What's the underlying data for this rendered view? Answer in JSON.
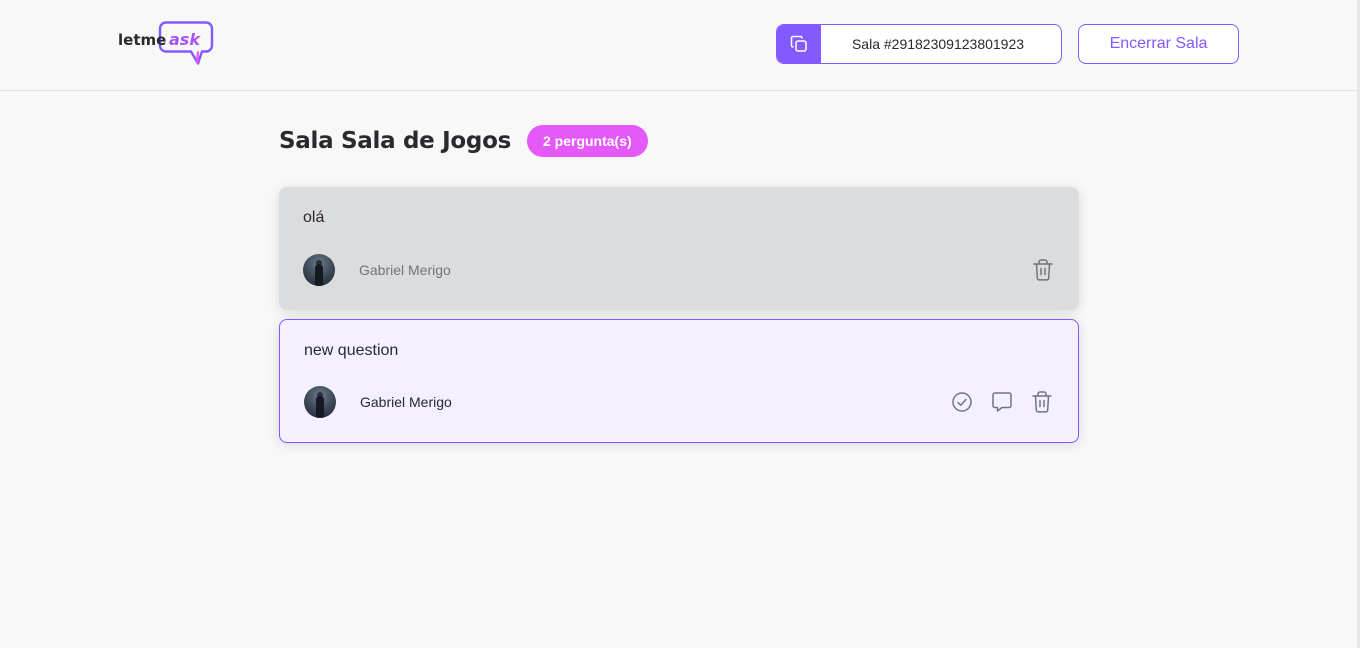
{
  "logo": {
    "text_left": "letme",
    "text_right": "ask"
  },
  "header": {
    "room_code_label": "Sala #29182309123801923",
    "close_room_label": "Encerrar Sala"
  },
  "room": {
    "title": "Sala Sala de Jogos",
    "question_count": "2 pergunta(s)"
  },
  "questions": [
    {
      "content": "olá",
      "author": "Gabriel Merigo",
      "state": "answered"
    },
    {
      "content": "new question",
      "author": "Gabriel Merigo",
      "state": "highlighted"
    }
  ],
  "colors": {
    "accent": "#835afd",
    "badge": "#e559f9",
    "answered_bg": "#dbdcdd",
    "highlighted_bg": "#f4f0ff"
  },
  "icons": {
    "copy": "copy-icon",
    "check": "check-circle-icon",
    "answer": "chat-bubble-icon",
    "delete": "trash-icon"
  }
}
